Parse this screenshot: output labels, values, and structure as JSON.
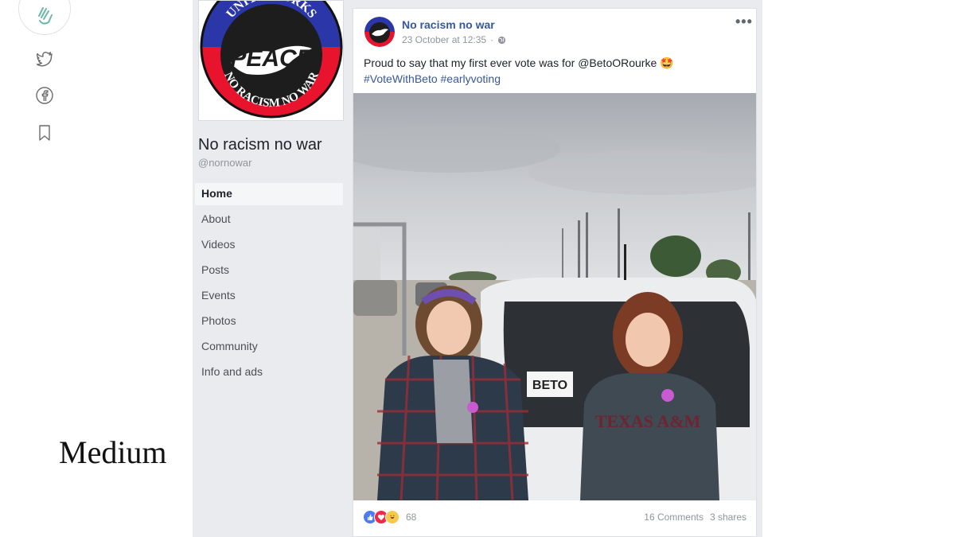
{
  "medium": {
    "label": "Medium",
    "icons": [
      "clap-icon",
      "twitter-icon",
      "facebook-icon",
      "bookmark-icon"
    ]
  },
  "page": {
    "cover_text_top": "UNITE WORKS",
    "cover_text_center": "PEACE",
    "cover_text_bottom": "NO RACISM NO WAR",
    "name": "No racism no war",
    "handle": "@nornowar",
    "nav": [
      {
        "label": "Home",
        "active": true
      },
      {
        "label": "About"
      },
      {
        "label": "Videos"
      },
      {
        "label": "Posts"
      },
      {
        "label": "Events"
      },
      {
        "label": "Photos"
      },
      {
        "label": "Community"
      },
      {
        "label": "Info and ads"
      }
    ]
  },
  "post": {
    "author": "No racism no war",
    "timestamp": "23 October at 12:35",
    "more": "•••",
    "text": "Proud to say that my first ever vote was for @BetoORourke 🤩",
    "hashtags": "#VoteWithBeto #earlyvoting",
    "sticker_text": "BETO",
    "reaction_count": "68",
    "comments": "16 Comments",
    "shares": "3 shares"
  },
  "colors": {
    "fb_link": "#365899",
    "fb_bg": "#e9ebee",
    "like_blue": "#4c7cf0",
    "love_red": "#f0284a",
    "haha_yellow": "#f7c94b"
  }
}
